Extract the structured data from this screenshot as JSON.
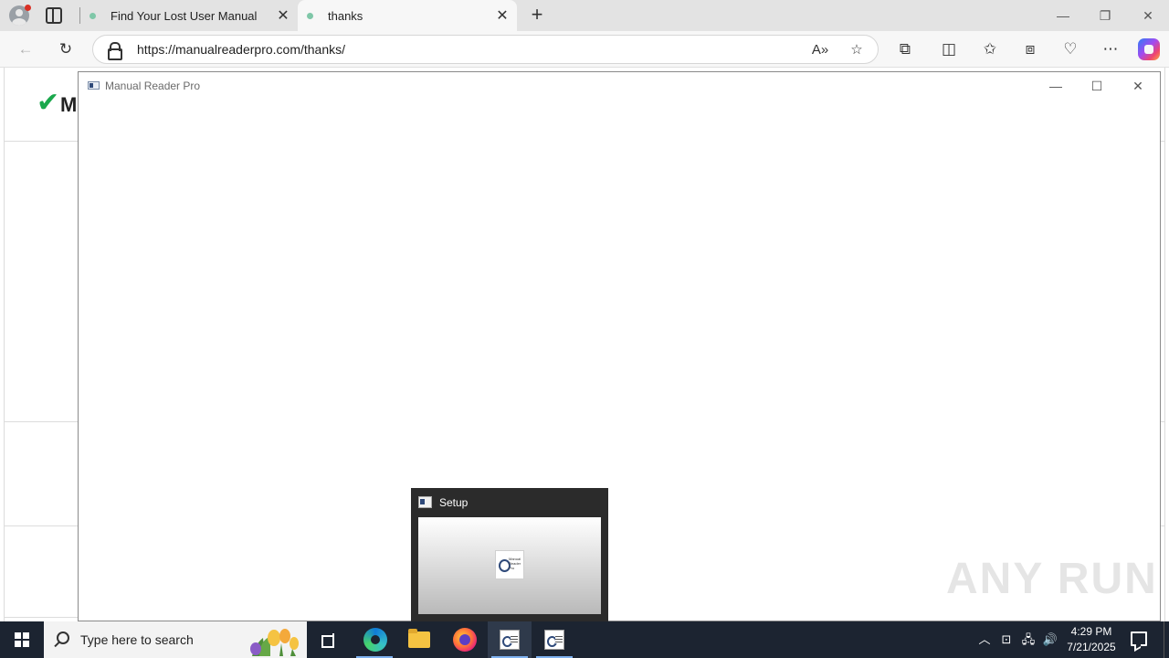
{
  "browser": {
    "tabs": [
      {
        "title": "Find Your Lost User Manual",
        "active": false
      },
      {
        "title": "thanks",
        "active": true
      }
    ],
    "new_tab_label": "+",
    "address": {
      "url": "https://manualreaderpro.com/thanks/"
    },
    "window_controls": {
      "minimize": "—",
      "restore": "❐",
      "close": "✕"
    }
  },
  "page_behind": {
    "logo_text": "Manual Reader Pro"
  },
  "app_window": {
    "title": "Manual Reader Pro",
    "controls": {
      "minimize": "—",
      "maximize": "☐",
      "close": "✕"
    }
  },
  "taskbar_preview": {
    "title": "Setup",
    "thumb_logo_text": "Manual Reader Pro"
  },
  "watermark": "ANY RUN",
  "taskbar": {
    "search_placeholder": "Type here to search",
    "clock": {
      "time": "4:29 PM",
      "date": "7/21/2025"
    }
  },
  "colors": {
    "taskbar": "#1c2431",
    "tab_strip": "#e3e3e3",
    "accent_check": "#1aa84c"
  }
}
